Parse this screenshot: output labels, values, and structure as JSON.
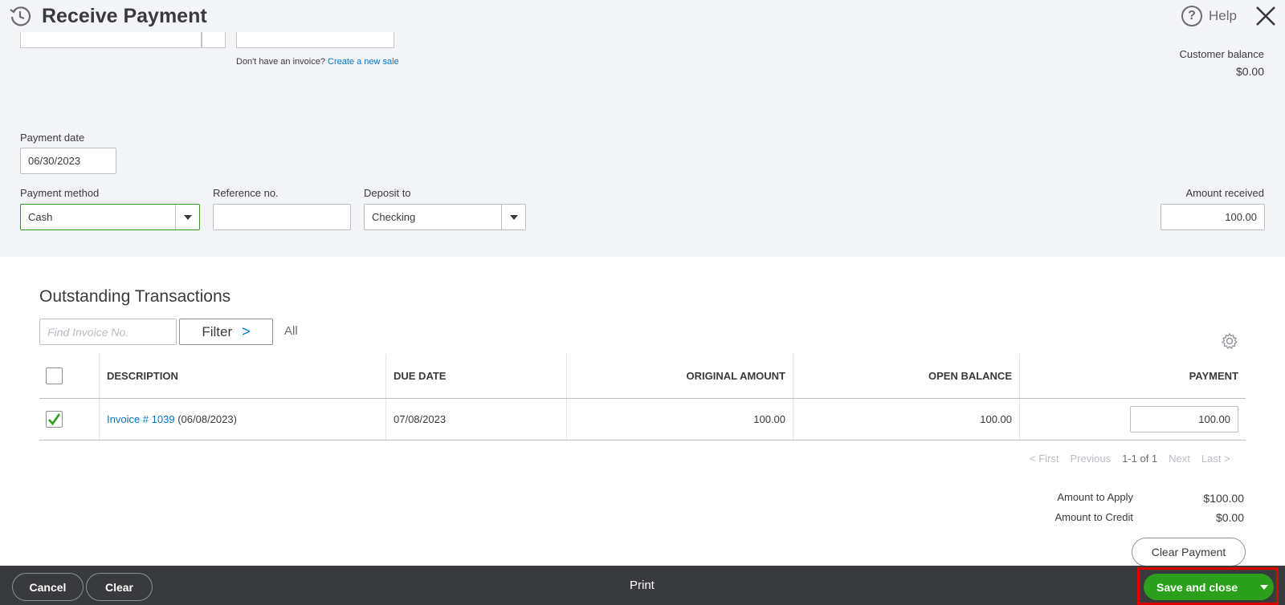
{
  "header": {
    "title": "Receive Payment",
    "help_label": "Help",
    "help_glyph": "?"
  },
  "invoice_hint": {
    "text": "Don't have an invoice?",
    "link": "Create a new sale"
  },
  "customer_balance": {
    "label": "Customer balance",
    "value": "$0.00"
  },
  "form": {
    "payment_date_label": "Payment date",
    "payment_date_value": "06/30/2023",
    "payment_method_label": "Payment method",
    "payment_method_value": "Cash",
    "reference_label": "Reference no.",
    "reference_value": "",
    "deposit_label": "Deposit to",
    "deposit_value": "Checking",
    "amount_label": "Amount received",
    "amount_value": "100.00"
  },
  "outstanding": {
    "title": "Outstanding Transactions",
    "find_placeholder": "Find Invoice No.",
    "filter_label": "Filter",
    "filter_chevron": ">",
    "all_label": "All",
    "columns": [
      "DESCRIPTION",
      "DUE DATE",
      "ORIGINAL AMOUNT",
      "OPEN BALANCE",
      "PAYMENT"
    ],
    "rows": [
      {
        "checked": true,
        "invoice_link": "Invoice # 1039",
        "invoice_date": "(06/08/2023)",
        "due_date": "07/08/2023",
        "original_amount": "100.00",
        "open_balance": "100.00",
        "payment": "100.00"
      }
    ],
    "pager": {
      "first": "< First",
      "previous": "Previous",
      "range": "1-1 of 1",
      "next": "Next",
      "last": "Last >"
    }
  },
  "summary": {
    "apply_label": "Amount to Apply",
    "apply_value": "$100.00",
    "credit_label": "Amount to Credit",
    "credit_value": "$0.00",
    "clear_payment_label": "Clear Payment"
  },
  "footer": {
    "cancel_label": "Cancel",
    "clear_label": "Clear",
    "print_label": "Print",
    "save_label": "Save and close"
  },
  "colors": {
    "accent_green": "#2ca01c",
    "link_blue": "#0077c5",
    "footer_bg": "#393a3d",
    "highlight_red": "#e00000"
  }
}
